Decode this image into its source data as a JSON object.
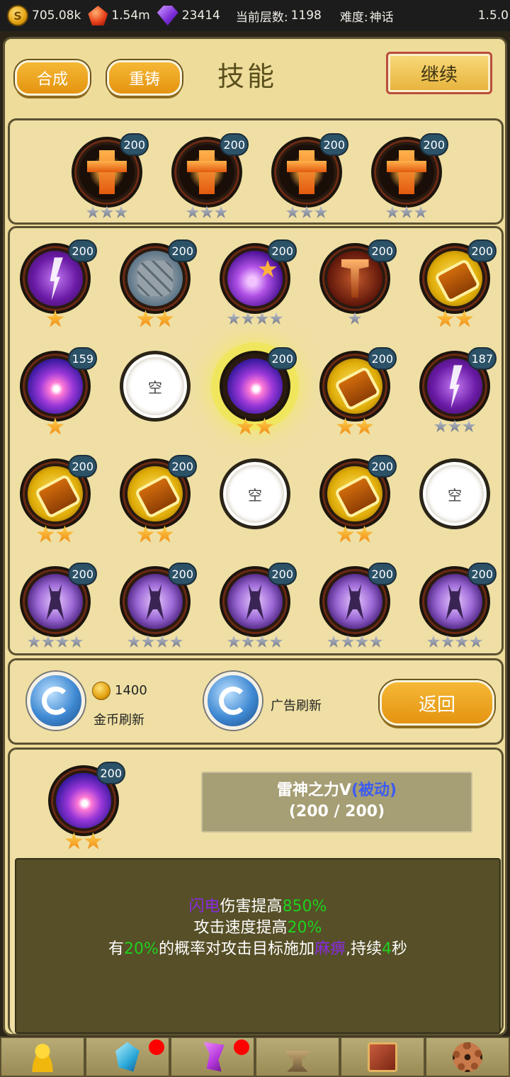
{
  "topbar": {
    "gold": "705.08k",
    "ruby": "1.54m",
    "gems": "23414",
    "floor_label": "当前层数:",
    "floor_value": "1198",
    "difficulty_label": "难度:",
    "difficulty_value": "神话",
    "version": "1.5.0"
  },
  "header": {
    "merge_label": "合成",
    "recast_label": "重铸",
    "title": "技能",
    "continue_label": "继续"
  },
  "equipped": [
    {
      "art": "cross",
      "level": "200",
      "stars": 3,
      "star_color": "grey"
    },
    {
      "art": "cross",
      "level": "200",
      "stars": 3,
      "star_color": "grey"
    },
    {
      "art": "cross",
      "level": "200",
      "stars": 3,
      "star_color": "grey"
    },
    {
      "art": "cross",
      "level": "200",
      "stars": 3,
      "star_color": "grey"
    }
  ],
  "inventory": [
    {
      "art": "lightning",
      "level": "200",
      "stars": 1,
      "star_color": "gold"
    },
    {
      "art": "rock",
      "level": "200",
      "stars": 2,
      "star_color": "gold"
    },
    {
      "art": "nebula",
      "level": "200",
      "stars": 4,
      "star_color": "grey"
    },
    {
      "art": "shield",
      "level": "200",
      "stars": 1,
      "star_color": "grey"
    },
    {
      "art": "gold",
      "level": "200",
      "stars": 2,
      "star_color": "gold"
    },
    {
      "art": "vortex",
      "level": "159",
      "stars": 1,
      "star_color": "gold"
    },
    {
      "art": "empty",
      "empty_label": "空"
    },
    {
      "art": "vortex",
      "level": "200",
      "stars": 2,
      "star_color": "gold",
      "selected": true
    },
    {
      "art": "gold",
      "level": "200",
      "stars": 2,
      "star_color": "gold"
    },
    {
      "art": "lightning",
      "level": "187",
      "stars": 3,
      "star_color": "grey"
    },
    {
      "art": "gold",
      "level": "200",
      "stars": 2,
      "star_color": "gold"
    },
    {
      "art": "gold",
      "level": "200",
      "stars": 2,
      "star_color": "gold"
    },
    {
      "art": "empty",
      "empty_label": "空"
    },
    {
      "art": "gold",
      "level": "200",
      "stars": 2,
      "star_color": "gold"
    },
    {
      "art": "empty",
      "empty_label": "空"
    },
    {
      "art": "demon",
      "level": "200",
      "stars": 4,
      "star_color": "grey"
    },
    {
      "art": "demon",
      "level": "200",
      "stars": 4,
      "star_color": "grey"
    },
    {
      "art": "demon",
      "level": "200",
      "stars": 4,
      "star_color": "grey"
    },
    {
      "art": "demon",
      "level": "200",
      "stars": 4,
      "star_color": "grey"
    },
    {
      "art": "demon",
      "level": "200",
      "stars": 4,
      "star_color": "grey"
    }
  ],
  "refresh": {
    "gold_cost": "1400",
    "gold_refresh_label": "金币刷新",
    "ad_refresh_label": "广告刷新",
    "back_label": "返回"
  },
  "detail": {
    "level": "200",
    "stars": 2,
    "name": "雷神之力V",
    "type": "(被动)",
    "progress": "(200 / 200)",
    "line1_a": "闪电",
    "line1_b": "伤害提高",
    "line1_c": "850%",
    "line2_a": "攻击速度提高",
    "line2_b": "20%",
    "line3_a": "有",
    "line3_b": "20%",
    "line3_c": "的概率对攻击目标施加",
    "line3_d": "麻痹",
    "line3_e": ",持续",
    "line3_f": "4",
    "line3_g": "秒"
  },
  "nav": {
    "tabs": [
      {
        "icon": "person-icon",
        "dot": false
      },
      {
        "icon": "crystal-icon",
        "dot": true
      },
      {
        "icon": "rune-icon",
        "dot": true
      },
      {
        "icon": "anvil-icon",
        "dot": false
      },
      {
        "icon": "book-icon",
        "dot": false
      },
      {
        "icon": "gear-icon",
        "dot": false
      }
    ]
  },
  "colors": {
    "accent_orange": "#e49410",
    "panel_bg": "#eedc9b",
    "highlight_green": "#1fd21f",
    "highlight_purple": "#8a2be2",
    "passive_blue": "#3d5cf0"
  }
}
